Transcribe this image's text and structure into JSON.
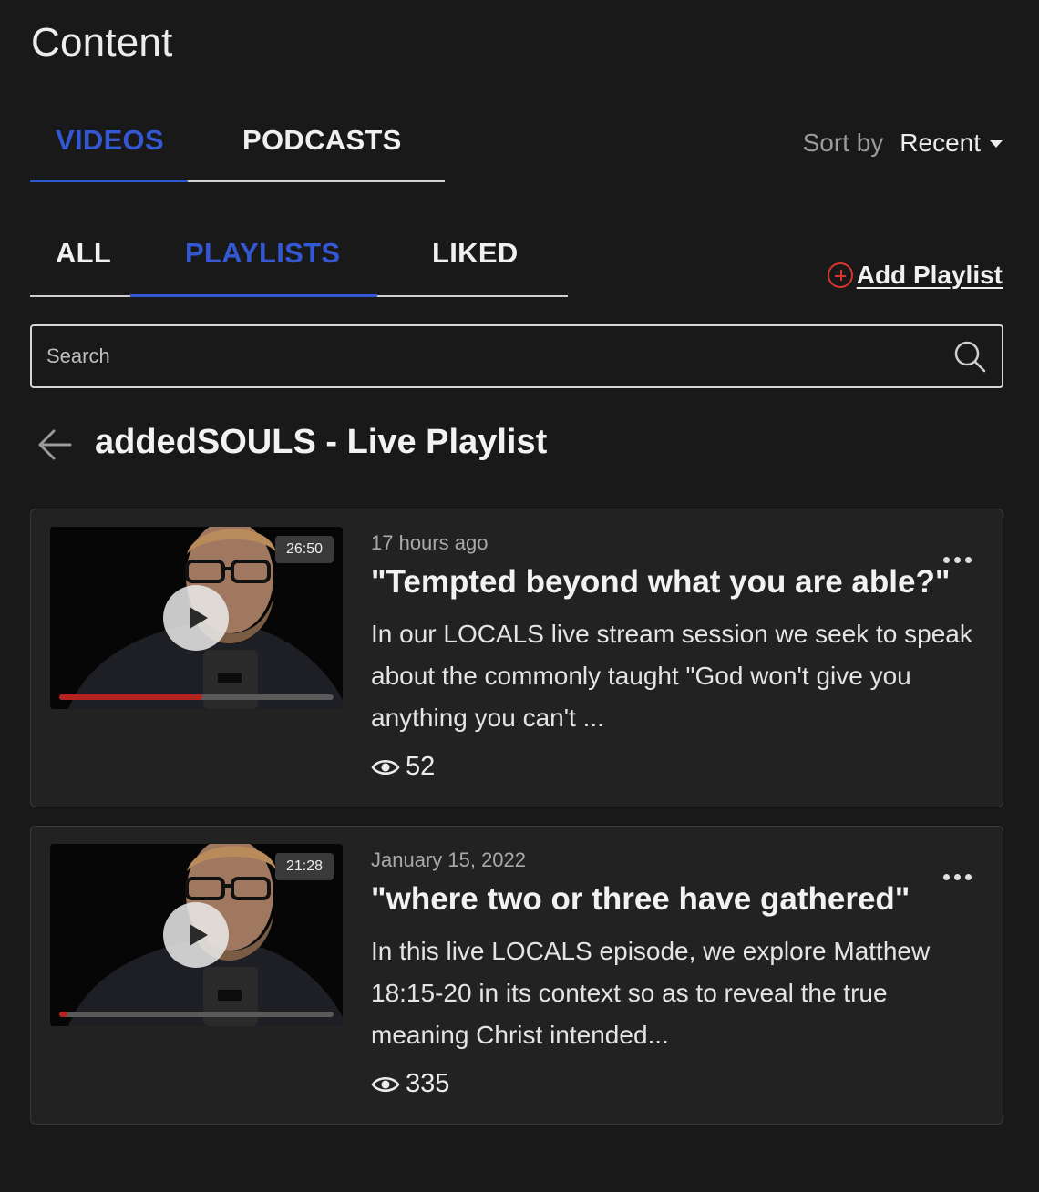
{
  "page": {
    "title": "Content"
  },
  "content_tabs": [
    {
      "label": "VIDEOS",
      "active": true
    },
    {
      "label": "PODCASTS",
      "active": false
    }
  ],
  "sort": {
    "label": "Sort by",
    "value": "Recent"
  },
  "filter_tabs": [
    {
      "label": "ALL",
      "active": false
    },
    {
      "label": "PLAYLISTS",
      "active": true
    },
    {
      "label": "LIKED",
      "active": false
    }
  ],
  "add_playlist": {
    "label": "Add Playlist"
  },
  "search": {
    "placeholder": "Search",
    "value": ""
  },
  "playlist": {
    "title": "addedSOULS - Live Playlist"
  },
  "videos": [
    {
      "duration": "26:50",
      "date": "17 hours ago",
      "title": "\"Tempted beyond what you are able?\"",
      "description": "In our LOCALS live stream session we seek to speak about the commonly taught \"God won't give you anything you can't ...",
      "views": "52",
      "progress": 0.52
    },
    {
      "duration": "21:28",
      "date": "January 15, 2022",
      "title": "\"where two or three have gathered\"",
      "description": "In this live LOCALS episode, we explore Matthew 18:15-20 in its context so as to reveal the true meaning Christ intended...",
      "views": "335",
      "progress": 0.03
    }
  ],
  "colors": {
    "background": "#191919",
    "accent": "#3458d4",
    "progress": "#b5231f",
    "add_icon": "#d8342f"
  },
  "icons": [
    "chevron-down-icon",
    "plus-circle-icon",
    "search-icon",
    "back-arrow-icon",
    "play-icon",
    "eye-icon",
    "more-icon"
  ]
}
